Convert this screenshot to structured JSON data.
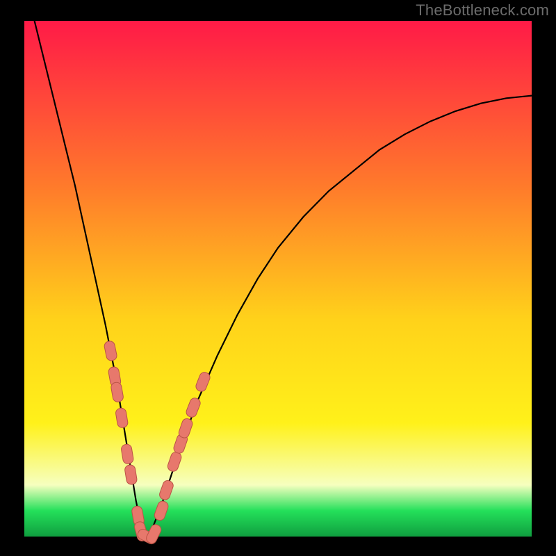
{
  "watermark": "TheBottleneck.com",
  "colors": {
    "frame": "#000000",
    "curve": "#000000",
    "marker_fill": "#e7786c",
    "marker_stroke": "#bb5446",
    "grad_top": "#ff1a47",
    "grad_mid_upper": "#ff7a2b",
    "grad_mid": "#ffd21a",
    "grad_mid_lower": "#fff11a",
    "grad_pale": "#f6ffbf",
    "grad_green": "#24e05a",
    "grad_dark_green": "#0f9e3f"
  },
  "chart_data": {
    "type": "line",
    "title": "",
    "xlabel": "",
    "ylabel": "",
    "xlim": [
      0,
      100
    ],
    "ylim": [
      0,
      100
    ],
    "series": [
      {
        "name": "bottleneck-curve",
        "x": [
          2,
          4,
          6,
          8,
          10,
          12,
          14,
          16,
          18,
          20,
          21,
          22,
          23,
          24,
          25,
          27,
          30,
          34,
          38,
          42,
          46,
          50,
          55,
          60,
          65,
          70,
          75,
          80,
          85,
          90,
          95,
          100
        ],
        "y": [
          100,
          92,
          84,
          76,
          68,
          59,
          50,
          41,
          31,
          19,
          13,
          7,
          2,
          0,
          1,
          6,
          15,
          26,
          35,
          43,
          50,
          56,
          62,
          67,
          71,
          75,
          78,
          80.5,
          82.5,
          84,
          85,
          85.5
        ]
      }
    ],
    "markers": {
      "name": "highlighted-points",
      "points": [
        {
          "x": 17.0,
          "y": 36
        },
        {
          "x": 17.8,
          "y": 31
        },
        {
          "x": 18.3,
          "y": 28
        },
        {
          "x": 19.2,
          "y": 23
        },
        {
          "x": 20.3,
          "y": 16
        },
        {
          "x": 21.0,
          "y": 12
        },
        {
          "x": 22.4,
          "y": 4
        },
        {
          "x": 23.0,
          "y": 1
        },
        {
          "x": 24.2,
          "y": 0
        },
        {
          "x": 25.5,
          "y": 0.5
        },
        {
          "x": 27.0,
          "y": 5
        },
        {
          "x": 28.0,
          "y": 9
        },
        {
          "x": 29.6,
          "y": 14.5
        },
        {
          "x": 30.8,
          "y": 18
        },
        {
          "x": 31.8,
          "y": 21
        },
        {
          "x": 33.3,
          "y": 25
        },
        {
          "x": 35.2,
          "y": 30
        }
      ]
    }
  }
}
